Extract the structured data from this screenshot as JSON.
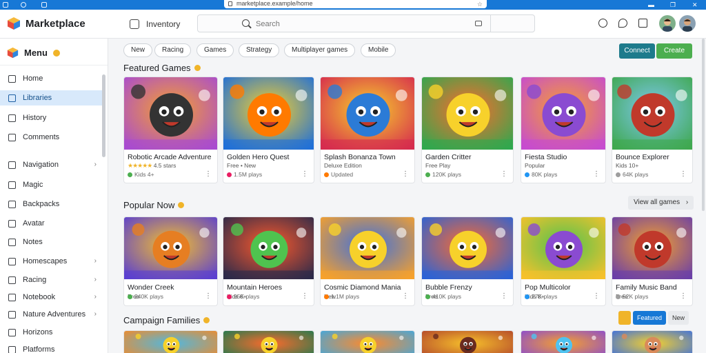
{
  "system": {
    "url": "marketplace.example/home"
  },
  "app": {
    "title": "Marketplace",
    "header_button": "Inventory",
    "search_placeholder": "Search"
  },
  "sidebar": {
    "heading": "Menu",
    "items": [
      {
        "label": "Home",
        "active": false,
        "chevron": false
      },
      {
        "label": "Libraries",
        "active": true,
        "chevron": false
      },
      {
        "label": "History",
        "active": false,
        "chevron": false
      },
      {
        "label": "Comments",
        "active": false,
        "chevron": false
      },
      {
        "label": "Navigation",
        "active": false,
        "chevron": true
      },
      {
        "label": "Magic",
        "active": false,
        "chevron": false
      },
      {
        "label": "Backpacks",
        "active": false,
        "chevron": false
      },
      {
        "label": "Avatar",
        "active": false,
        "chevron": false
      },
      {
        "label": "Notes",
        "active": false,
        "chevron": false
      },
      {
        "label": "Homescapes",
        "active": false,
        "chevron": true
      },
      {
        "label": "Racing",
        "active": false,
        "chevron": true
      },
      {
        "label": "Notebook",
        "active": false,
        "chevron": true
      },
      {
        "label": "Nature Adventures",
        "active": false,
        "chevron": true
      },
      {
        "label": "Horizons",
        "active": false,
        "chevron": false
      },
      {
        "label": "Platforms",
        "active": false,
        "chevron": false
      }
    ]
  },
  "filters": [
    "New",
    "Racing",
    "Games",
    "Strategy",
    "Multiplayer games",
    "Mobile"
  ],
  "actions": {
    "primary": "Connect",
    "secondary": "Create"
  },
  "sections": [
    {
      "title": "Featured Games",
      "cards": [
        {
          "title": "Robotic Arcade Adventure",
          "meta": "4.5 stars",
          "meta2": "Kids 4+",
          "rating": 4.5
        },
        {
          "title": "Golden Hero Quest",
          "meta": "Free • New",
          "meta2": "1.5M plays",
          "rating": null
        },
        {
          "title": "Splash Bonanza Town",
          "meta": "Deluxe Edition",
          "meta2": "Updated",
          "rating": null
        },
        {
          "title": "Garden Critter",
          "meta": "Free Play",
          "meta2": "120K plays",
          "rating": null
        },
        {
          "title": "Fiesta Studio",
          "meta": "Popular",
          "meta2": "80K plays",
          "rating": null
        },
        {
          "title": "Bounce Explorer",
          "meta": "Kids 10+",
          "meta2": "64K plays",
          "rating": null
        }
      ]
    },
    {
      "title": "Popular Now",
      "see_all": "View all games",
      "cards": [
        {
          "title": "Wonder Creek",
          "meta": "Free",
          "meta2": "240K plays"
        },
        {
          "title": "Mountain Heroes",
          "meta": "Kids 6+",
          "meta2": "95K plays"
        },
        {
          "title": "Cosmic Diamond Mania",
          "meta": "New",
          "meta2": "1.1M plays"
        },
        {
          "title": "Bubble Frenzy",
          "meta": "Free",
          "meta2": "410K plays"
        },
        {
          "title": "Pop Multicolor",
          "meta": "Kids 8+",
          "meta2": "77K plays"
        },
        {
          "title": "Family Music Band",
          "meta": "Free",
          "meta2": "52K plays"
        }
      ]
    },
    {
      "title": "Campaign Families",
      "pills": [
        "Featured",
        "New"
      ]
    }
  ]
}
